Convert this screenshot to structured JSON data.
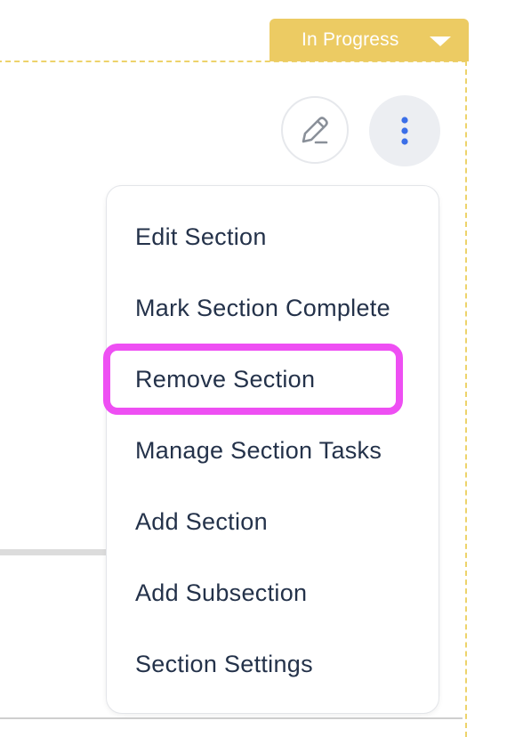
{
  "status": {
    "label": "In Progress",
    "color": "#eccb63"
  },
  "actions": {
    "edit_icon": "pencil-icon",
    "more_icon": "vertical-ellipsis-icon",
    "more_icon_color": "#3b6fe8"
  },
  "menu": {
    "items": [
      {
        "label": "Edit Section"
      },
      {
        "label": "Mark Section Complete"
      },
      {
        "label": "Remove Section"
      },
      {
        "label": "Manage Section Tasks"
      },
      {
        "label": "Add Section"
      },
      {
        "label": "Add Subsection"
      },
      {
        "label": "Section Settings"
      }
    ],
    "highlighted_item": "Remove Section",
    "highlight_color": "#ee4ff3"
  }
}
